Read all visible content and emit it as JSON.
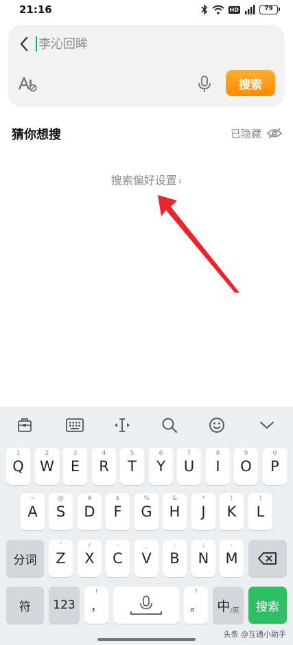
{
  "status_bar": {
    "time": "21:16",
    "hd": "HD",
    "battery": "79"
  },
  "search": {
    "placeholder": "李沁回眸",
    "button_label": "搜索"
  },
  "guess": {
    "title": "猜你想搜",
    "hidden_label": "已隐藏",
    "preference_link": "搜索偏好设置",
    "chevron": "›"
  },
  "keyboard": {
    "toolbar_icons": [
      "clipboard-icon",
      "keyboard-icon",
      "cursor-move-icon",
      "search-icon",
      "emoji-icon",
      "collapse-icon"
    ],
    "row1": [
      {
        "main": "Q",
        "sub": "1"
      },
      {
        "main": "W",
        "sub": "2"
      },
      {
        "main": "E",
        "sub": "3"
      },
      {
        "main": "R",
        "sub": "4"
      },
      {
        "main": "T",
        "sub": "5"
      },
      {
        "main": "Y",
        "sub": "6"
      },
      {
        "main": "U",
        "sub": "7"
      },
      {
        "main": "I",
        "sub": "8"
      },
      {
        "main": "O",
        "sub": "9"
      },
      {
        "main": "P",
        "sub": "0"
      }
    ],
    "row2": [
      {
        "main": "A",
        "sub": "~"
      },
      {
        "main": "S",
        "sub": "@"
      },
      {
        "main": "D",
        "sub": "#"
      },
      {
        "main": "F",
        "sub": "$"
      },
      {
        "main": "G",
        "sub": "%"
      },
      {
        "main": "H",
        "sub": "&"
      },
      {
        "main": "J",
        "sub": "*"
      },
      {
        "main": "K",
        "sub": "("
      },
      {
        "main": "L",
        "sub": ")"
      }
    ],
    "row3": [
      {
        "main": "Z",
        "sub": "'"
      },
      {
        "main": "X",
        "sub": "/"
      },
      {
        "main": "C",
        "sub": "-"
      },
      {
        "main": "V",
        "sub": "_"
      },
      {
        "main": "B",
        "sub": ":"
      },
      {
        "main": "N",
        "sub": ";"
      },
      {
        "main": "M",
        "sub": "·"
      }
    ],
    "fenci": "分词",
    "fu": "符",
    "num": "123",
    "comma": "，",
    "comma_sub": "!",
    "period": "。",
    "period_sub": "?",
    "zhong": "中",
    "ying": "/英",
    "enter": "搜索"
  },
  "watermark": "头条 @互通小助手",
  "colors": {
    "accent_orange": "#ff8a00",
    "enter_green": "#2fbe63",
    "arrow_red": "#e8262b",
    "caret_teal": "#1ea784"
  }
}
